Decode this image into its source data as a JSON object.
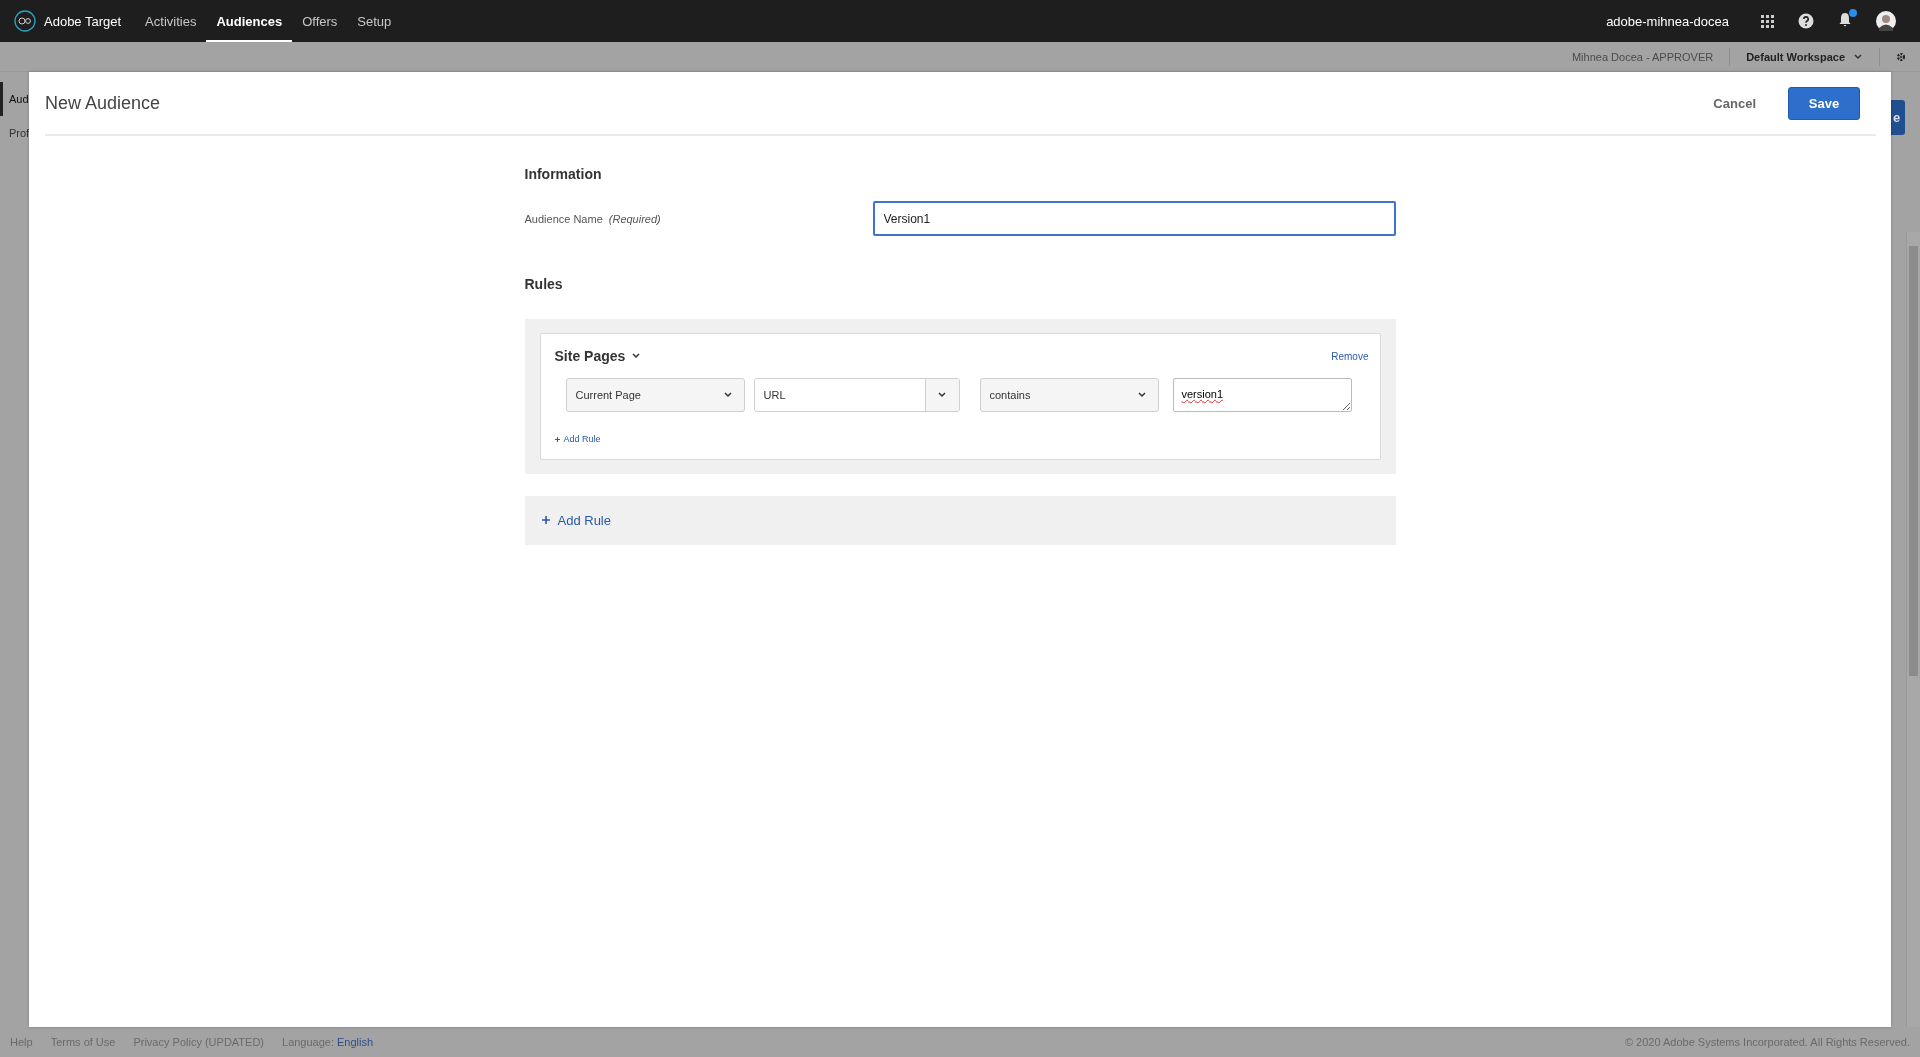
{
  "topbar": {
    "product": "Adobe Target",
    "nav": [
      {
        "label": "Activities",
        "selected": false
      },
      {
        "label": "Audiences",
        "selected": true
      },
      {
        "label": "Offers",
        "selected": false
      },
      {
        "label": "Setup",
        "selected": false
      }
    ],
    "org": "adobe-mihnea-docea",
    "notification_badge": true
  },
  "subbar": {
    "user": "Mihnea Docea - APPROVER",
    "workspace": "Default Workspace"
  },
  "background": {
    "sidebar_items": [
      {
        "label": "Aud",
        "selected": true
      },
      {
        "label": "Prof",
        "selected": false
      }
    ],
    "button_label": "e"
  },
  "modal": {
    "title": "New Audience",
    "cancel": "Cancel",
    "save": "Save",
    "information_heading": "Information",
    "name_label": "Audience Name",
    "name_required": "(Required)",
    "name_value": "Version1",
    "rules_heading": "Rules",
    "rule_groups": [
      {
        "title": "Site Pages",
        "remove": "Remove",
        "add_rule": "Add Rule",
        "conditions": [
          {
            "kind": "select",
            "value": "Current Page"
          },
          {
            "kind": "combo",
            "value": "URL"
          },
          {
            "kind": "select",
            "value": "contains"
          },
          {
            "kind": "textarea",
            "value": "version1"
          }
        ]
      }
    ],
    "add_rule": "Add Rule"
  },
  "footer": {
    "links": [
      "Help",
      "Terms of Use",
      "Privacy Policy (UPDATED)"
    ],
    "language_label": "Language:",
    "language": "English",
    "copyright": "© 2020 Adobe Systems Incorporated. All Rights Reserved."
  }
}
